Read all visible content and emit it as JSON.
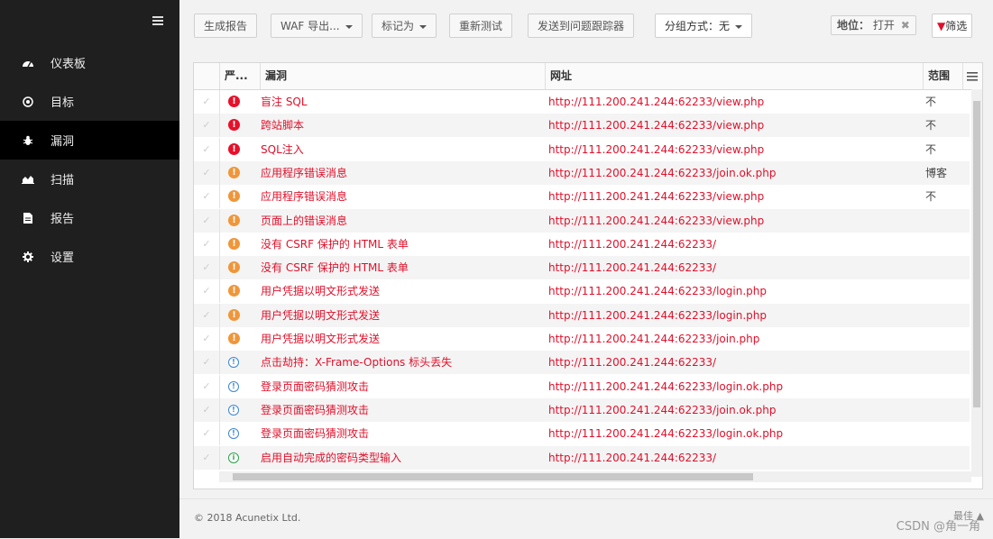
{
  "sidebar": {
    "items": [
      {
        "label": "仪表板",
        "icon": "dashboard-icon"
      },
      {
        "label": "目标",
        "icon": "target-icon"
      },
      {
        "label": "漏洞",
        "icon": "bug-icon",
        "active": true
      },
      {
        "label": "扫描",
        "icon": "area-chart-icon"
      },
      {
        "label": "报告",
        "icon": "document-icon"
      },
      {
        "label": "设置",
        "icon": "gear-icon"
      }
    ]
  },
  "toolbar": {
    "generate_report": "生成报告",
    "waf_export": "WAF 导出...",
    "mark_as": "标记为",
    "retest": "重新测试",
    "send_to_tracker": "发送到问题跟踪器",
    "group_by": "分组方式：无",
    "status_filter_label": "地位：",
    "status_filter_value": "打开",
    "filter": "筛选"
  },
  "table": {
    "headers": {
      "severity": "严...",
      "vuln": "漏洞",
      "url": "网址",
      "scope": "范围"
    },
    "rows": [
      {
        "severity": "high",
        "name": "盲注 SQL",
        "url": "http://111.200.241.244:62233/view.php",
        "scope": "不"
      },
      {
        "severity": "high",
        "name": "跨站脚本",
        "url": "http://111.200.241.244:62233/view.php",
        "scope": "不"
      },
      {
        "severity": "high",
        "name": "SQL注入",
        "url": "http://111.200.241.244:62233/view.php",
        "scope": "不"
      },
      {
        "severity": "medium",
        "name": "应用程序错误消息",
        "url": "http://111.200.241.244:62233/join.ok.php",
        "scope": "博客"
      },
      {
        "severity": "medium",
        "name": "应用程序错误消息",
        "url": "http://111.200.241.244:62233/view.php",
        "scope": "不"
      },
      {
        "severity": "medium",
        "name": "页面上的错误消息",
        "url": "http://111.200.241.244:62233/view.php",
        "scope": ""
      },
      {
        "severity": "medium",
        "name": "没有 CSRF 保护的 HTML 表单",
        "url": "http://111.200.241.244:62233/",
        "scope": ""
      },
      {
        "severity": "medium",
        "name": "没有 CSRF 保护的 HTML 表单",
        "url": "http://111.200.241.244:62233/",
        "scope": ""
      },
      {
        "severity": "medium",
        "name": "用户凭据以明文形式发送",
        "url": "http://111.200.241.244:62233/login.php",
        "scope": ""
      },
      {
        "severity": "medium",
        "name": "用户凭据以明文形式发送",
        "url": "http://111.200.241.244:62233/login.php",
        "scope": ""
      },
      {
        "severity": "medium",
        "name": "用户凭据以明文形式发送",
        "url": "http://111.200.241.244:62233/join.php",
        "scope": ""
      },
      {
        "severity": "low",
        "name": "点击劫持：X-Frame-Options 标头丢失",
        "url": "http://111.200.241.244:62233/",
        "scope": ""
      },
      {
        "severity": "low",
        "name": "登录页面密码猜测攻击",
        "url": "http://111.200.241.244:62233/login.ok.php",
        "scope": ""
      },
      {
        "severity": "low",
        "name": "登录页面密码猜测攻击",
        "url": "http://111.200.241.244:62233/join.ok.php",
        "scope": ""
      },
      {
        "severity": "low",
        "name": "登录页面密码猜测攻击",
        "url": "http://111.200.241.244:62233/login.ok.php",
        "scope": ""
      },
      {
        "severity": "info",
        "name": "启用自动完成的密码类型输入",
        "url": "http://111.200.241.244:62233/",
        "scope": ""
      }
    ]
  },
  "footer": {
    "copyright": "© 2018 Acunetix Ltd.",
    "back_to_top": "最佳"
  },
  "watermark": "CSDN @角一角",
  "colors": {
    "sidebar_bg": "#1f1f1f",
    "high": "#e8102a",
    "medium": "#f0963a",
    "low": "#3d86d4",
    "info": "#2aa34a",
    "link_red": "#e0102a"
  }
}
